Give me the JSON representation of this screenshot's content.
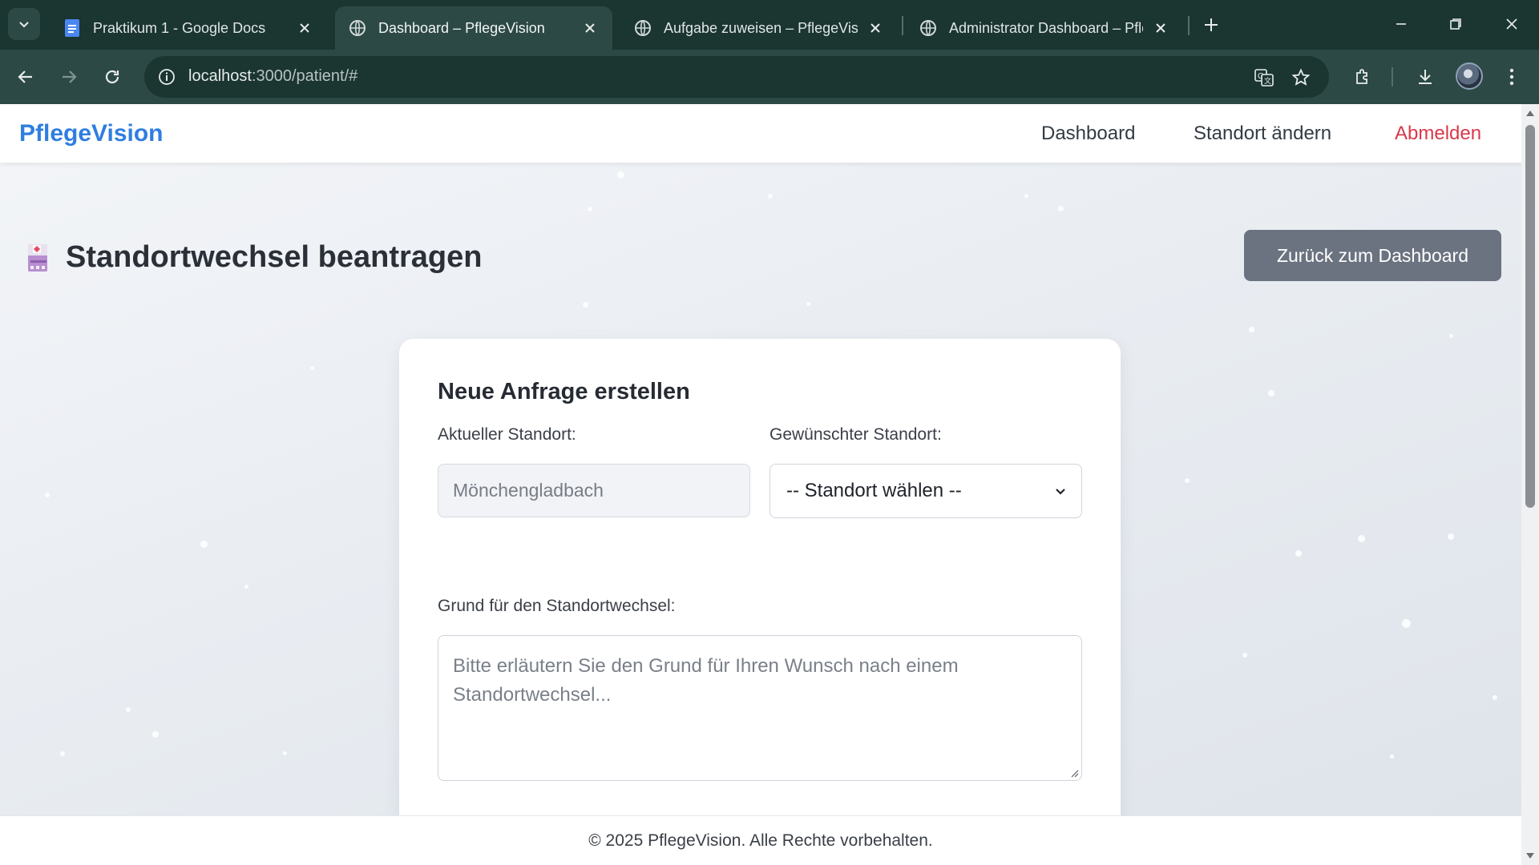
{
  "browser": {
    "tabs": [
      {
        "title": "Praktikum 1 - Google Docs",
        "icon": "google-docs-icon",
        "active": false
      },
      {
        "title": "Dashboard – PflegeVision",
        "icon": "globe-icon",
        "active": true
      },
      {
        "title": "Aufgabe zuweisen – PflegeVision",
        "icon": "globe-icon",
        "active": false
      },
      {
        "title": "Administrator Dashboard – PflegeVision",
        "icon": "globe-icon",
        "active": false
      }
    ],
    "url_host": "localhost",
    "url_rest": ":3000/patient/#"
  },
  "app": {
    "brand": "PflegeVision",
    "nav": {
      "dashboard": "Dashboard",
      "change_location": "Standort ändern",
      "logout": "Abmelden"
    },
    "page_title": "Standortwechsel beantragen",
    "back_button": "Zurück zum Dashboard",
    "form": {
      "heading": "Neue Anfrage erstellen",
      "current_label": "Aktueller Standort:",
      "current_value": "Mönchengladbach",
      "desired_label": "Gewünschter Standort:",
      "desired_selected": "-- Standort wählen --",
      "reason_label": "Grund für den Standortwechsel:",
      "reason_placeholder_line1": "Bitte erläutern Sie den Grund für Ihren Wunsch nach einem",
      "reason_placeholder_line2": "Standortwechsel..."
    },
    "footer": "© 2025 PflegeVision. Alle Rechte vorbehalten."
  },
  "colors": {
    "brand": "#2f7ee0",
    "logout": "#d9394a",
    "back_button": "#6b7280",
    "chrome": "#1b3531"
  }
}
